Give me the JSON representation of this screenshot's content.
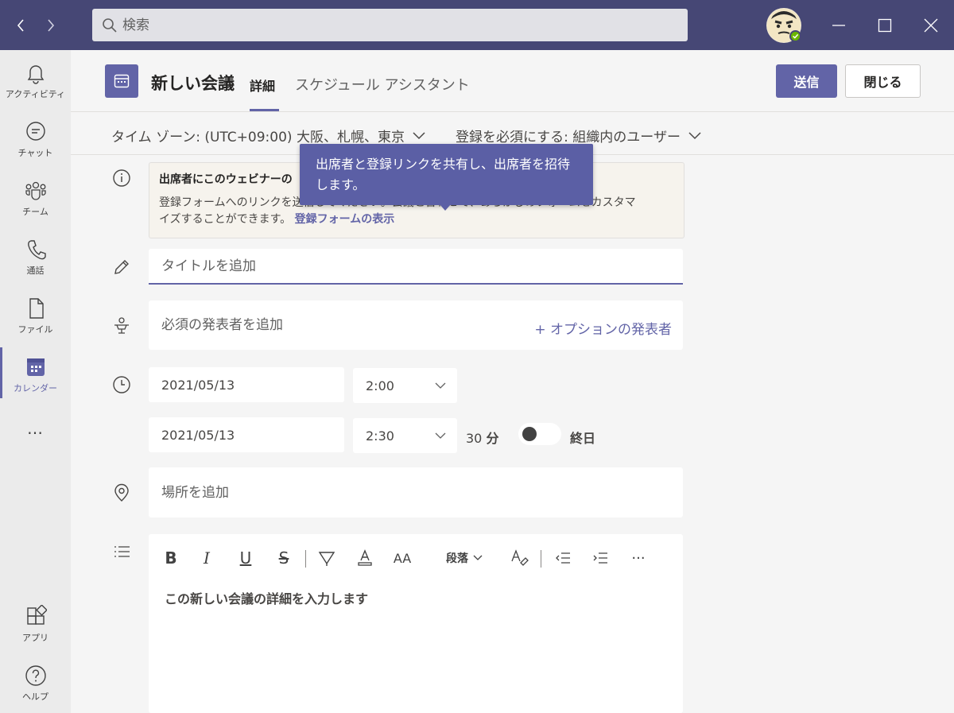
{
  "titlebar": {
    "search_placeholder": "検索",
    "nav_back_icon": "chevron-left-icon",
    "nav_forward_icon": "chevron-right-icon",
    "window_buttons": [
      "minimize-icon",
      "maximize-icon",
      "close-icon"
    ]
  },
  "rail": {
    "items": [
      {
        "label": "アクティビティ",
        "icon": "bell-icon"
      },
      {
        "label": "チャット",
        "icon": "chat-icon"
      },
      {
        "label": "チーム",
        "icon": "teams-icon"
      },
      {
        "label": "通話",
        "icon": "phone-icon"
      },
      {
        "label": "ファイル",
        "icon": "file-icon"
      },
      {
        "label": "カレンダー",
        "icon": "calendar-icon",
        "active": true
      },
      {
        "label": "…",
        "icon": "more-icon"
      },
      {
        "label": "アプリ",
        "icon": "apps-icon"
      },
      {
        "label": "ヘルプ",
        "icon": "help-icon"
      }
    ]
  },
  "header": {
    "title": "新しい会議",
    "tabs": [
      {
        "label": "詳細",
        "active": true
      },
      {
        "label": "スケジュール アシスタント"
      }
    ],
    "send_label": "送信",
    "close_label": "閉じる"
  },
  "options": {
    "timezone": "タイム ゾーン: (UTC+09:00) 大阪、札幌、東京",
    "registration": "登録を必須にする: 組織内のユーザー"
  },
  "banner": {
    "title": "出席者にこのウェビナーの",
    "body": "登録フォームへのリンクを送信してください。会議と合わせて、あらかじめフォームをカスタマイズすることができます。",
    "link": "登録フォームの表示"
  },
  "tooltip": {
    "text": "出席者と登録リンクを共有し、出席者を招待します。"
  },
  "form": {
    "title_placeholder": "タイトルを追加",
    "presenter_placeholder": "必須の発表者を追加",
    "optional_presenter": "+ オプションの発表者",
    "start_date": "2021/05/13",
    "start_time": "2:00",
    "end_date": "2021/05/13",
    "end_time": "2:30",
    "duration_number": "30",
    "duration_unit": "分",
    "allday_label": "終日",
    "allday_on": false,
    "location_placeholder": "場所を追加",
    "editor": {
      "paragraph_label": "段落",
      "placeholder": "この新しい会議の詳細を入力します"
    }
  },
  "colors": {
    "titlebar": "#464775",
    "accent": "#6264a7",
    "rail_bg": "#ebebeb",
    "page_bg": "#f5f5f5",
    "presence": "#6bb700"
  }
}
